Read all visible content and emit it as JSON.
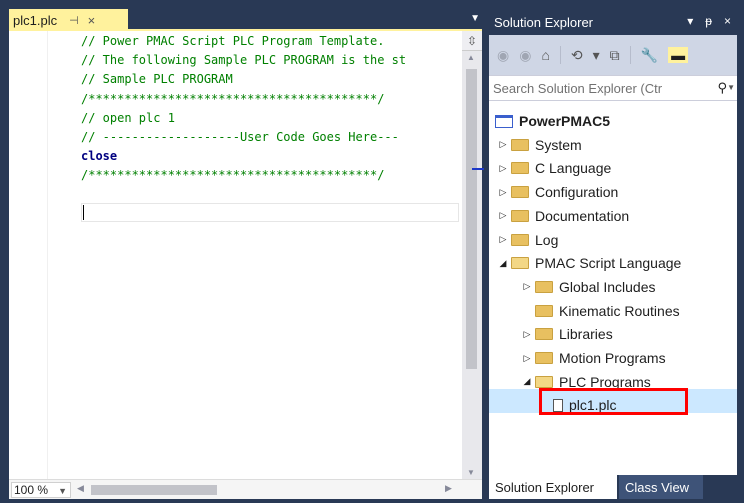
{
  "editor": {
    "tab_title": "plc1.plc",
    "pin_glyph": "⊣",
    "close_glyph": "×",
    "dropdown_glyph": "▼",
    "splitter_glyph": "⇳",
    "lines": [
      {
        "text": "// Power PMAC Script PLC Program Template.",
        "kind": "comment"
      },
      {
        "text": "// The following Sample PLC PROGRAM is the st",
        "kind": "comment"
      },
      {
        "text": "// Sample PLC PROGRAM",
        "kind": "comment"
      },
      {
        "text": "/****************************************/",
        "kind": "comment"
      },
      {
        "text": "// open plc 1",
        "kind": "comment"
      },
      {
        "text": "// -------------------User Code Goes Here---",
        "kind": "comment"
      },
      {
        "text": "close",
        "kind": "keyword"
      },
      {
        "text": "/****************************************/",
        "kind": "comment"
      }
    ],
    "zoom": "100 %"
  },
  "solution_explorer": {
    "title": "Solution Explorer",
    "header_buttons": [
      "▾",
      "ᵽ",
      "×"
    ],
    "toolbar": {
      "back_icon": "◉",
      "forward_icon": "◉",
      "home_icon": "⌂",
      "history_icon": "⟲",
      "dropdown_icon": "▾",
      "copy_icon": "⧉",
      "properties_icon": "🔧",
      "pin_icon": "▬"
    },
    "search_placeholder": "Search Solution Explorer (Ctr",
    "search_icon": "⚲",
    "tree": [
      {
        "label": "PowerPMAC5",
        "icon": "solution",
        "expander": "",
        "level": 0,
        "bold": true
      },
      {
        "label": "System",
        "icon": "folder",
        "expander": "▷",
        "level": 0
      },
      {
        "label": "C Language",
        "icon": "folder",
        "expander": "▷",
        "level": 0
      },
      {
        "label": "Configuration",
        "icon": "folder",
        "expander": "▷",
        "level": 0
      },
      {
        "label": "Documentation",
        "icon": "folder",
        "expander": "▷",
        "level": 0
      },
      {
        "label": "Log",
        "icon": "folder",
        "expander": "▷",
        "level": 0
      },
      {
        "label": "PMAC Script Language",
        "icon": "folder-open",
        "expander": "◢",
        "level": 0
      },
      {
        "label": "Global Includes",
        "icon": "folder",
        "expander": "▷",
        "level": 1
      },
      {
        "label": "Kinematic Routines",
        "icon": "folder",
        "expander": "",
        "level": 1
      },
      {
        "label": "Libraries",
        "icon": "folder",
        "expander": "▷",
        "level": 1
      },
      {
        "label": "Motion Programs",
        "icon": "folder",
        "expander": "▷",
        "level": 1
      },
      {
        "label": "PLC Programs",
        "icon": "folder-open",
        "expander": "◢",
        "level": 1
      },
      {
        "label": "plc1.plc",
        "icon": "file",
        "expander": "",
        "level": 2,
        "selected": true
      }
    ],
    "bottom_tabs": [
      "Solution Explorer",
      "Class View"
    ]
  },
  "colors": {
    "chrome": "#293955",
    "active_tab": "#fff29d",
    "comment": "#008000",
    "keyword": "#000080",
    "highlight_box": "#ff0000",
    "selection": "#cce8ff"
  }
}
